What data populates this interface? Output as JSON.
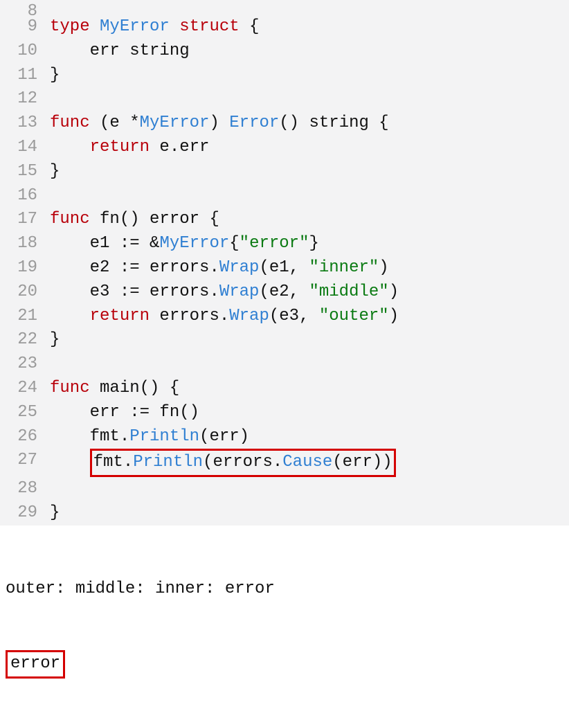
{
  "gutters": {
    "l8": "8",
    "l9": "9",
    "l10": "10",
    "l11": "11",
    "l12": "12",
    "l13": "13",
    "l14": "14",
    "l15": "15",
    "l16": "16",
    "l17": "17",
    "l18": "18",
    "l19": "19",
    "l20": "20",
    "l21": "21",
    "l22": "22",
    "l23": "23",
    "l24": "24",
    "l25": "25",
    "l26": "26",
    "l27": "27",
    "l28": "28",
    "l29": "29"
  },
  "tok": {
    "type": "type",
    "struct": "struct",
    "func": "func",
    "return": "return",
    "MyError": "MyError",
    "Error": "Error",
    "Wrap": "Wrap",
    "Println": "Println",
    "Cause": "Cause",
    "errstr": "err string",
    "lbrace": " {",
    "rbrace": "}",
    "openparen": "(",
    "closeparen": ")",
    "space": " ",
    "indent": "    ",
    "receiver": " (e *",
    "afterRecv": ") ",
    "sigErrorRet": "() string {",
    "returnEerr": " e.err",
    "fn": " fn() error {",
    "e1": "e1 := &",
    "e1b": "{",
    "s_error": "\"error\"",
    "e1c": "}",
    "e2": "e2 := errors.",
    "e2b": "(e1, ",
    "s_inner": "\"inner\"",
    "e2c": ")",
    "e3": "e3 := errors.",
    "e3b": "(e2, ",
    "s_middle": "\"middle\"",
    "e3c": ")",
    "ret3": " errors.",
    "ret3b": "(e3, ",
    "s_outer": "\"outer\"",
    "ret3c": ")",
    "main": " main() {",
    "errAssign": "err := fn()",
    "fmt": "fmt.",
    "println1": "(err)",
    "println2a": "(errors.",
    "println2b": "(err))"
  },
  "output": {
    "line1": "outer: middle: inner: error",
    "line2": "error"
  }
}
